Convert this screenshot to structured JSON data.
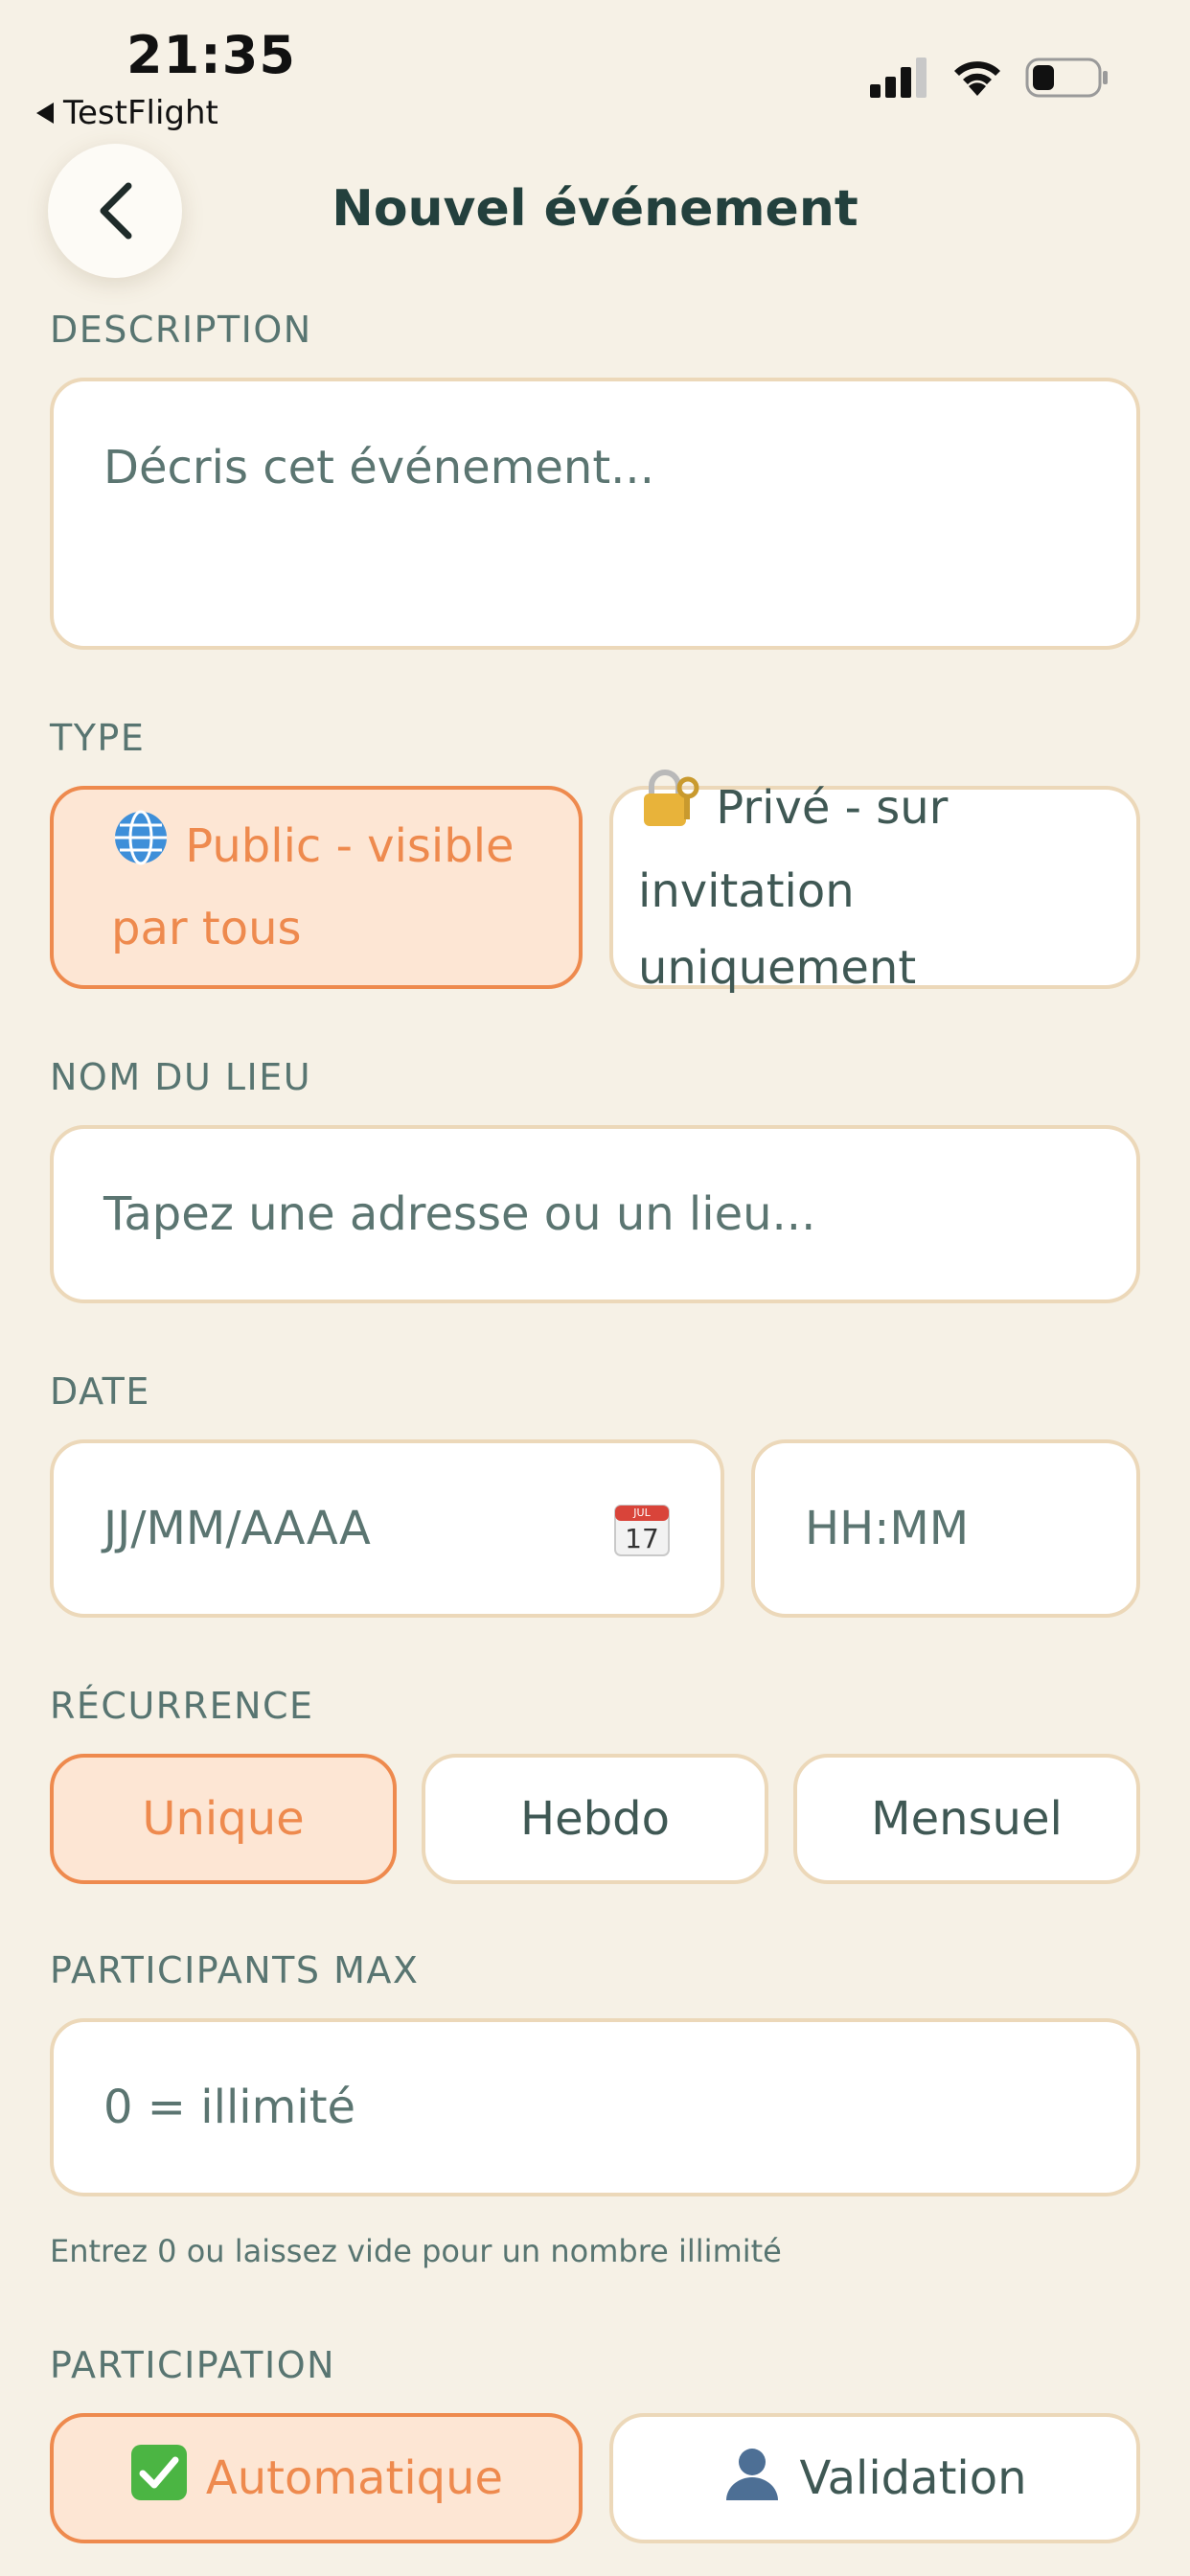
{
  "status_bar": {
    "time": "21:35",
    "back_app": "TestFlight"
  },
  "header": {
    "title": "Nouvel événement"
  },
  "description": {
    "label": "DESCRIPTION",
    "placeholder": "Décris cet événement..."
  },
  "type": {
    "label": "TYPE",
    "public_label": "Public - visible par tous",
    "private_label": "Privé - sur invitation uniquement",
    "selected": "public"
  },
  "location": {
    "label": "NOM DU LIEU",
    "placeholder": "Tapez une adresse ou un lieu..."
  },
  "date": {
    "label": "DATE",
    "date_placeholder": "JJ/MM/AAAA",
    "calendar_month": "JUL",
    "calendar_day": "17",
    "time_placeholder": "HH:MM"
  },
  "recurrence": {
    "label": "RÉCURRENCE",
    "options": [
      "Unique",
      "Hebdo",
      "Mensuel"
    ],
    "selected": "Unique"
  },
  "participants": {
    "label": "PARTICIPANTS MAX",
    "placeholder": "0 = illimité",
    "helper": "Entrez 0 ou laissez vide pour un nombre illimité"
  },
  "participation": {
    "label": "PARTICIPATION",
    "auto_label": "Automatique",
    "validation_label": "Validation",
    "selected": "auto"
  },
  "colors": {
    "accent": "#ee8a4e",
    "accent_bg": "#fde6d4",
    "border": "#ecd8b9",
    "background": "#f6f1e6"
  }
}
